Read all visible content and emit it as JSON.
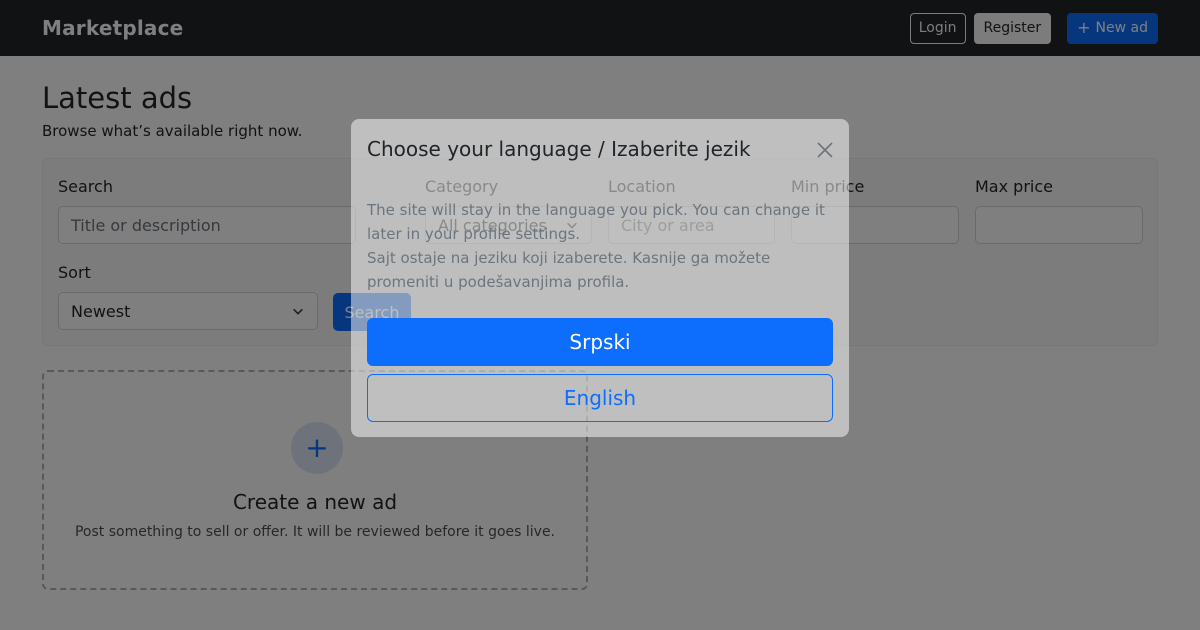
{
  "navbar": {
    "brand": "Marketplace",
    "login_label": "Login",
    "register_label": "Register",
    "new_ad_label": "New ad"
  },
  "main": {
    "title": "Latest ads",
    "subtitle": "Browse what’s available right now."
  },
  "filters": {
    "search_label": "Search",
    "search_placeholder": "Title or description",
    "category_label": "Category",
    "category_value": "All categories",
    "location_label": "Location",
    "location_placeholder": "City or area",
    "min_price_label": "Min price",
    "max_price_label": "Max price",
    "sort_label": "Sort",
    "sort_value": "Newest",
    "search_button": "Search"
  },
  "create_card": {
    "icon": "plus-icon",
    "title": "Create a new ad",
    "text": "Post something to sell or offer. It will be reviewed before it goes live."
  },
  "modal": {
    "title": "Choose your language / Izaberite jezik",
    "text_en_line1": "The site will stay in the language you pick. You can change it",
    "text_en_line2": "later in your profile settings.",
    "text_sr_line1": "Sajt ostaje na jeziku koji izaberete. Kasnije ga možete",
    "text_sr_line2": "promeniti u podešavanjima profila.",
    "option_srpski": "Srpski",
    "option_english": "English"
  },
  "colors": {
    "navbar_bg": "#212529",
    "primary": "#0d6efd",
    "backdrop": "rgba(0,0,0,0.5)"
  }
}
